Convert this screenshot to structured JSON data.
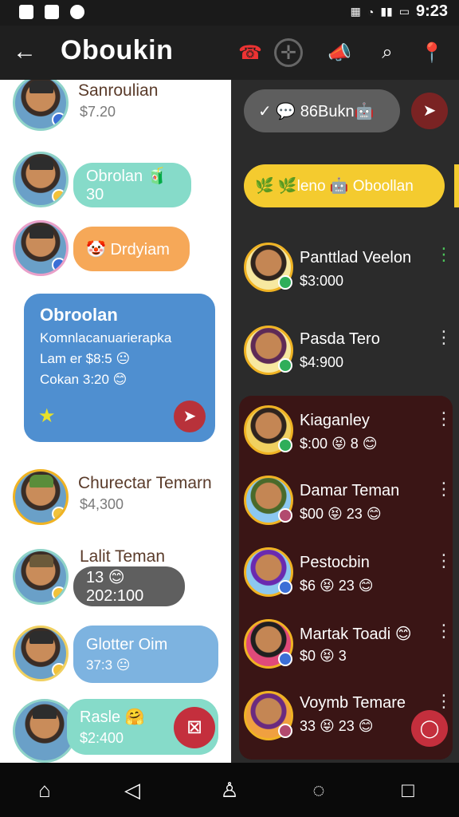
{
  "status_bar": {
    "time": "9:23"
  },
  "app_bar": {
    "title": "Oboukin"
  },
  "left_chats": [
    {
      "name": "Sanroulian",
      "price": "$7.20"
    },
    {
      "bubble": "Obrolan 🧃 30"
    },
    {
      "bubble": "🤡 Drdyiam"
    },
    {
      "name": "Churectar Temarn",
      "price": "$4,300"
    },
    {
      "name": "Lalit Teman",
      "bubble": "13 😊 202:100"
    },
    {
      "bubble_title": "Glotter Oim",
      "bubble_sub": "37:3 😐"
    },
    {
      "name": "Rasle 🤗",
      "price": "$2:400"
    }
  ],
  "big_card": {
    "title": "Obroolan",
    "lines": [
      "Komnlacanuarierapka",
      "Lam er $8:5 😐",
      "Cokan 3:20 😊"
    ]
  },
  "right_top": {
    "pill": "✓ 💬 86Bukn🤖",
    "tag": "🌿 🌿leno 🤖 Oboollan"
  },
  "right_contacts": [
    {
      "name": "Panttlad Veelon",
      "price": "$3:000"
    },
    {
      "name": "Pasda Tero",
      "price": "$4:900"
    },
    {
      "name": "Kiaganley",
      "price": "$:00 😝 8 😊"
    },
    {
      "name": "Damar Teman",
      "price": "$00 😝 23 😊"
    },
    {
      "name": "Pestocbin",
      "price": "$6 😝 23 😊"
    },
    {
      "name": "Martak Toadi 😊",
      "price": "$0 😝 3"
    },
    {
      "name": "Voymb Temare",
      "price": "33 😝 23 😊"
    }
  ]
}
